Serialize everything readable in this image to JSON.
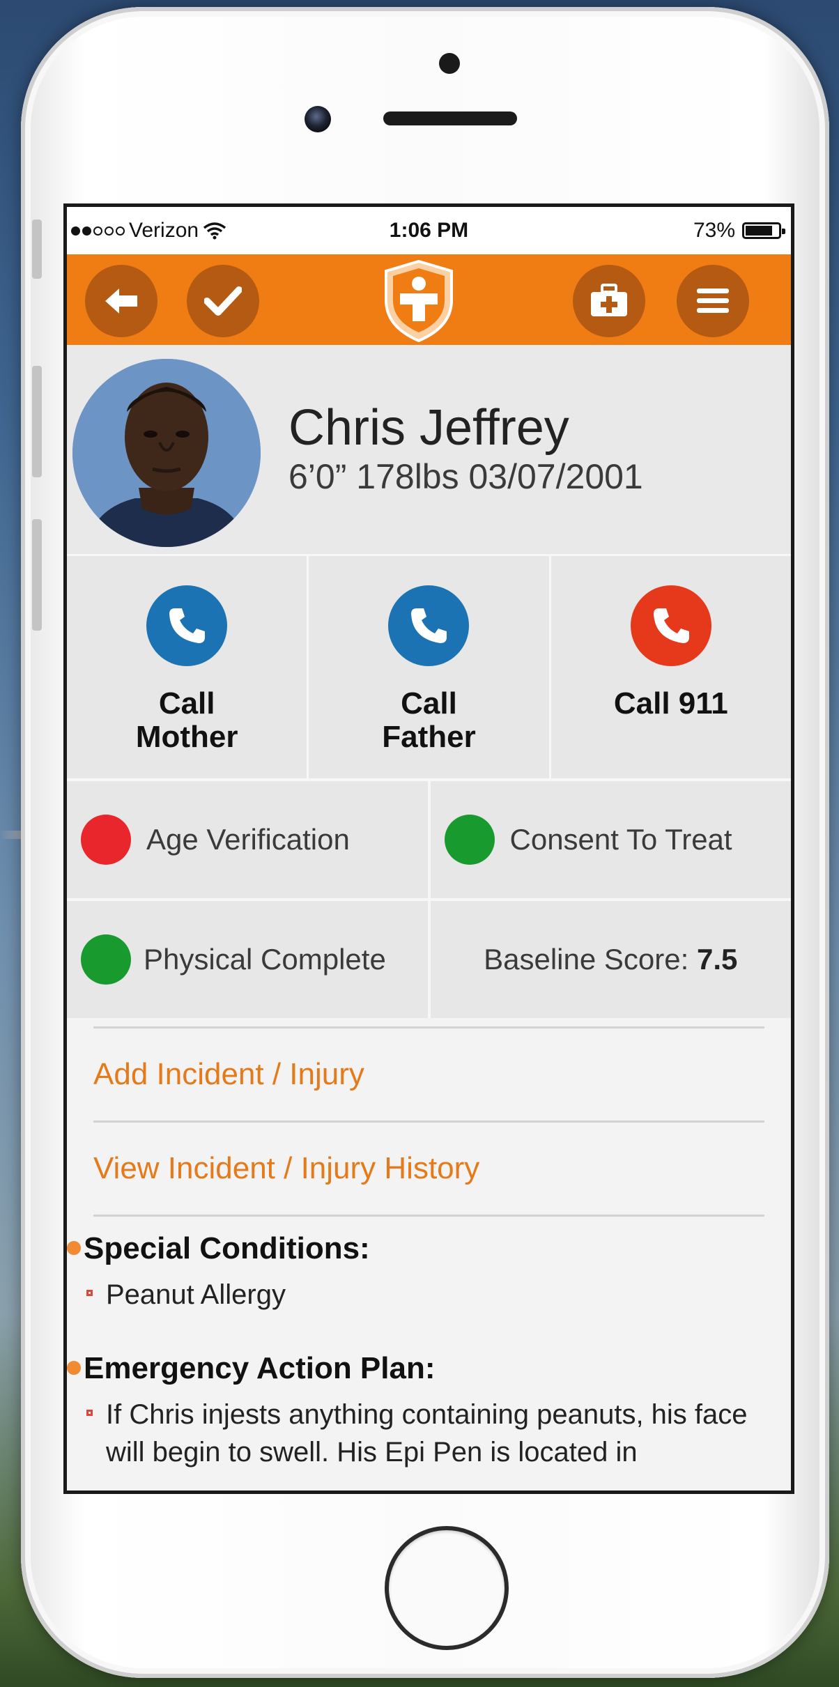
{
  "status_bar": {
    "carrier": "Verizon",
    "time": "1:06 PM",
    "battery": "73%"
  },
  "app_bar": {
    "icons": [
      "back-arrow-icon",
      "checkmark-icon",
      "shield-medical-logo",
      "first-aid-kit-icon",
      "menu-icon"
    ]
  },
  "profile": {
    "name": "Chris Jeffrey",
    "stats": "6’0” 178lbs 03/07/2001"
  },
  "calls": [
    {
      "label_line1": "Call",
      "label_line2": "Mother",
      "color": "#1b73b4"
    },
    {
      "label_line1": "Call",
      "label_line2": "Father",
      "color": "#1b73b4"
    },
    {
      "label_line1": "Call 911",
      "label_line2": "",
      "color": "#e6391c"
    }
  ],
  "statuses": {
    "age_verification": {
      "label": "Age Verification",
      "color": "#e8262c"
    },
    "consent_to_treat": {
      "label": "Consent To Treat",
      "color": "#199a2e"
    },
    "physical_complete": {
      "label": "Physical Complete",
      "color": "#199a2e"
    },
    "baseline": {
      "label": "Baseline Score:",
      "value": "7.5"
    }
  },
  "links": {
    "add_incident": "Add Incident / Injury",
    "view_history": "View Incident / Injury History"
  },
  "special_conditions": {
    "title": "Special Conditions:",
    "items": [
      "Peanut Allergy"
    ]
  },
  "emergency_plan": {
    "title": "Emergency Action Plan:",
    "items": [
      "If Chris injests anything containing peanuts, his face will begin to swell. His Epi Pen is located in"
    ]
  },
  "colors": {
    "accent": "#f07d14",
    "link": "#e57a1a"
  }
}
